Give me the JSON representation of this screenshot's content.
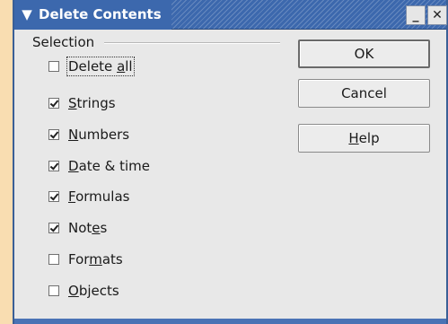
{
  "window": {
    "title": "Delete Contents",
    "menu_icon": "chevron-down-icon",
    "minimize_icon": "minimize-icon",
    "close_icon": "close-icon",
    "minimize_glyph": "_",
    "close_glyph": "✕"
  },
  "selection": {
    "label": "Selection",
    "items": [
      {
        "key": "delete_all",
        "mnemonic_pre": "Delete ",
        "mnemonic": "a",
        "mnemonic_post": "ll",
        "checked": false
      },
      {
        "key": "strings",
        "mnemonic_pre": "",
        "mnemonic": "S",
        "mnemonic_post": "trings",
        "checked": true
      },
      {
        "key": "numbers",
        "mnemonic_pre": "",
        "mnemonic": "N",
        "mnemonic_post": "umbers",
        "checked": true
      },
      {
        "key": "date_time",
        "mnemonic_pre": "",
        "mnemonic": "D",
        "mnemonic_post": "ate & time",
        "checked": true
      },
      {
        "key": "formulas",
        "mnemonic_pre": "",
        "mnemonic": "F",
        "mnemonic_post": "ormulas",
        "checked": true
      },
      {
        "key": "notes",
        "mnemonic_pre": "Not",
        "mnemonic": "e",
        "mnemonic_post": "s",
        "checked": true
      },
      {
        "key": "formats",
        "mnemonic_pre": "For",
        "mnemonic": "m",
        "mnemonic_post": "ats",
        "checked": false
      },
      {
        "key": "objects",
        "mnemonic_pre": "",
        "mnemonic": "O",
        "mnemonic_post": "bjects",
        "checked": false
      }
    ]
  },
  "buttons": {
    "ok": "OK",
    "cancel": "Cancel",
    "help_pre": "",
    "help_mnemonic": "H",
    "help_post": "elp"
  }
}
